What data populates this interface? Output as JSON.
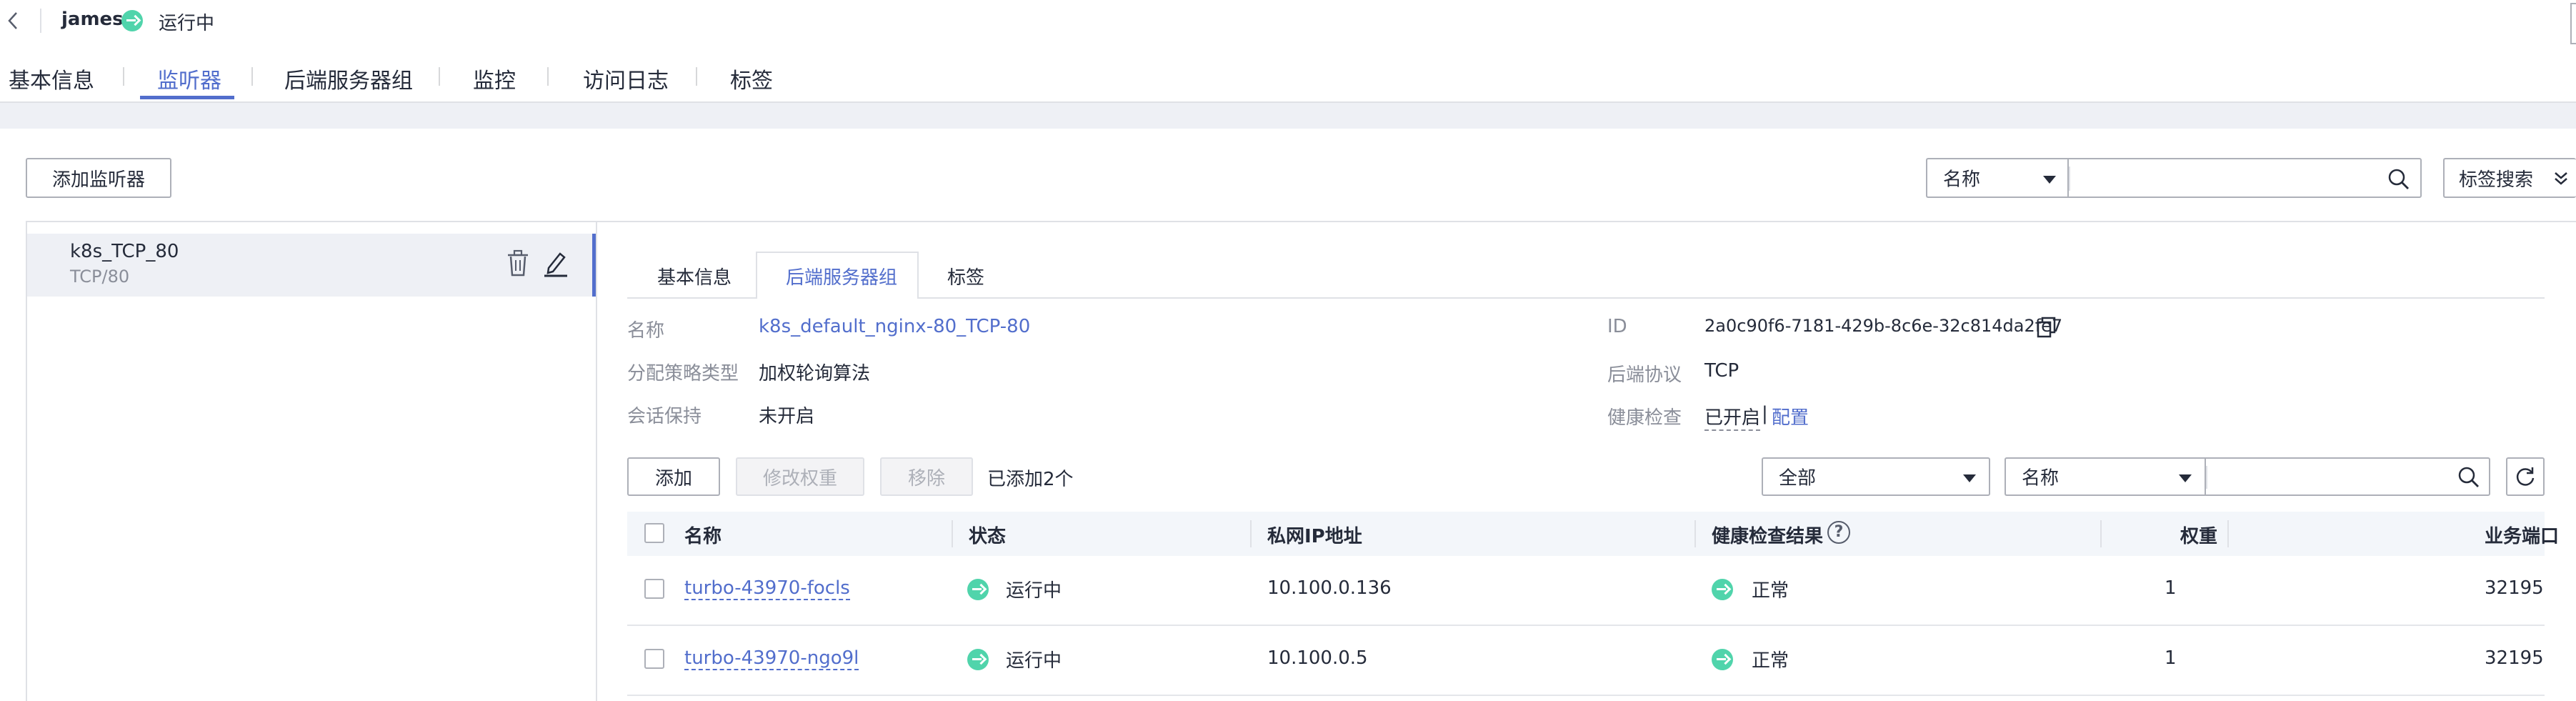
{
  "header": {
    "instance_name": "james",
    "status": "运行中"
  },
  "top_tabs": [
    "基本信息",
    "监听器",
    "后端服务器组",
    "监控",
    "访问日志",
    "标签"
  ],
  "toolbar": {
    "add_listener": "添加监听器",
    "search_field_select": "名称",
    "tag_search": "标签搜索"
  },
  "listener": {
    "name": "k8s_TCP_80",
    "protocol_port": "TCP/80"
  },
  "detail_tabs": [
    "基本信息",
    "后端服务器组",
    "标签"
  ],
  "group_info": {
    "name_label": "名称",
    "name_value": "k8s_default_nginx-80_TCP-80",
    "algorithm_label": "分配策略类型",
    "algorithm_value": "加权轮询算法",
    "session_label": "会话保持",
    "session_value": "未开启",
    "id_label": "ID",
    "id_value": "2a0c90f6-7181-429b-8c6e-32c814da2fe7",
    "protocol_label": "后端协议",
    "protocol_value": "TCP",
    "health_label": "健康检查",
    "health_value": "已开启",
    "health_sep": "|",
    "health_config": "配置"
  },
  "server_toolbar": {
    "add": "添加",
    "modify_weight": "修改权重",
    "remove": "移除",
    "added_count": "已添加2个",
    "filter_all": "全部",
    "filter_field": "名称"
  },
  "table": {
    "headers": [
      "名称",
      "状态",
      "私网IP地址",
      "健康检查结果",
      "权重",
      "业务端口"
    ],
    "rows": [
      {
        "name": "turbo-43970-focls",
        "status": "运行中",
        "ip": "10.100.0.136",
        "health": "正常",
        "weight": "1",
        "port": "32195"
      },
      {
        "name": "turbo-43970-ngo9l",
        "status": "运行中",
        "ip": "10.100.0.5",
        "health": "正常",
        "weight": "1",
        "port": "32195"
      }
    ]
  },
  "colors": {
    "accent": "#526ecc",
    "running_green": "#50d4ab",
    "listener_selected_bg": "#eef0f5",
    "table_header_bg": "#f3f6fa"
  }
}
